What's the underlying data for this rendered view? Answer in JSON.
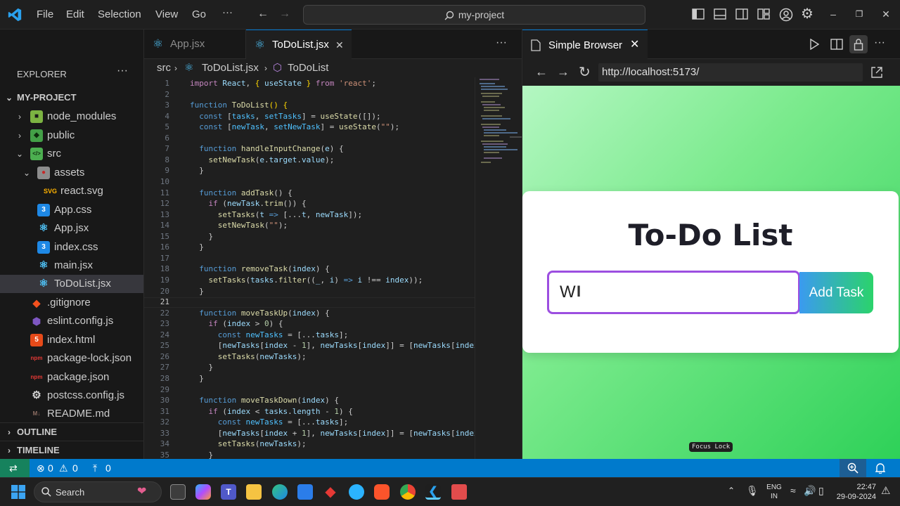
{
  "titlebar": {
    "menus": [
      "File",
      "Edit",
      "Selection",
      "View",
      "Go",
      "···"
    ],
    "search": "my-project"
  },
  "sidebar": {
    "header": "EXPLORER",
    "more": "···",
    "project": "MY-PROJECT",
    "items": [
      {
        "label": "node_modules",
        "icon": "folder-node-icon"
      },
      {
        "label": "public",
        "icon": "folder-public-icon"
      },
      {
        "label": "src",
        "icon": "folder-src-icon"
      },
      {
        "label": "assets",
        "icon": "folder-assets-icon"
      },
      {
        "label": "react.svg",
        "icon": "svg-file-icon"
      },
      {
        "label": "App.css",
        "icon": "css-file-icon"
      },
      {
        "label": "App.jsx",
        "icon": "react-file-icon"
      },
      {
        "label": "index.css",
        "icon": "css-file-icon"
      },
      {
        "label": "main.jsx",
        "icon": "react-file-icon"
      },
      {
        "label": "ToDoList.jsx",
        "icon": "react-file-icon"
      },
      {
        "label": ".gitignore",
        "icon": "git-file-icon"
      },
      {
        "label": "eslint.config.js",
        "icon": "eslint-file-icon"
      },
      {
        "label": "index.html",
        "icon": "html-file-icon"
      },
      {
        "label": "package-lock.json",
        "icon": "npm-file-icon"
      },
      {
        "label": "package.json",
        "icon": "npm-file-icon"
      },
      {
        "label": "postcss.config.js",
        "icon": "gear-file-icon"
      },
      {
        "label": "README.md",
        "icon": "markdown-file-icon"
      }
    ],
    "outline": "OUTLINE",
    "timeline": "TIMELINE"
  },
  "editor": {
    "tabs": [
      {
        "label": "App.jsx",
        "active": false
      },
      {
        "label": "ToDoList.jsx",
        "active": true
      }
    ],
    "tabs_more": "···",
    "breadcrumb": {
      "folder": "src",
      "file": "ToDoList.jsx",
      "symbol": "ToDoList"
    },
    "active_line": 21
  },
  "browser": {
    "tab_title": "Simple Browser",
    "url": "http://localhost:5173/",
    "page": {
      "title": "To-Do List",
      "input_value": "W",
      "add_button": "Add Task"
    },
    "focus_lock": "Focus Lock"
  },
  "statusbar": {
    "errors": "0",
    "warnings": "0",
    "ports": "0"
  },
  "taskbar": {
    "search": "Search",
    "lang": "ENG",
    "region": "IN",
    "time": "22:47",
    "date": "29-09-2024"
  },
  "colors": {
    "accent": "#007acc",
    "todo_border": "#9c4ee0",
    "page_gradient_end": "#2ed158"
  }
}
